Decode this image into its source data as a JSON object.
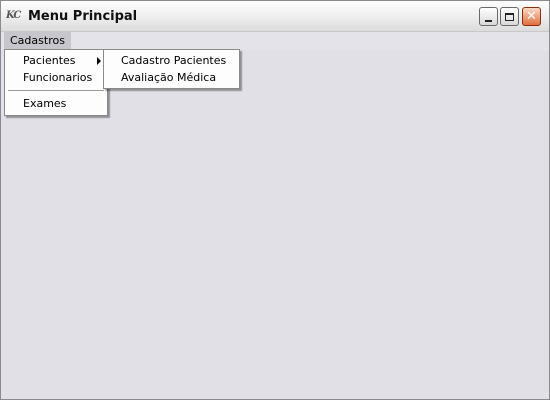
{
  "window": {
    "title": "Menu Principal",
    "icon": "app-logo-icon",
    "icon_text": "KC"
  },
  "controls": {
    "close_glyph": "✕"
  },
  "menubar": {
    "menus": [
      {
        "label": "Cadastros"
      }
    ]
  },
  "cadastros_menu": {
    "items": [
      {
        "label": "Pacientes",
        "has_submenu": true
      },
      {
        "label": "Funcionarios"
      },
      {
        "label": "Exames"
      }
    ]
  },
  "pacientes_submenu": {
    "items": [
      {
        "label": "Cadastro Pacientes"
      },
      {
        "label": "Avaliação Médica"
      }
    ]
  }
}
